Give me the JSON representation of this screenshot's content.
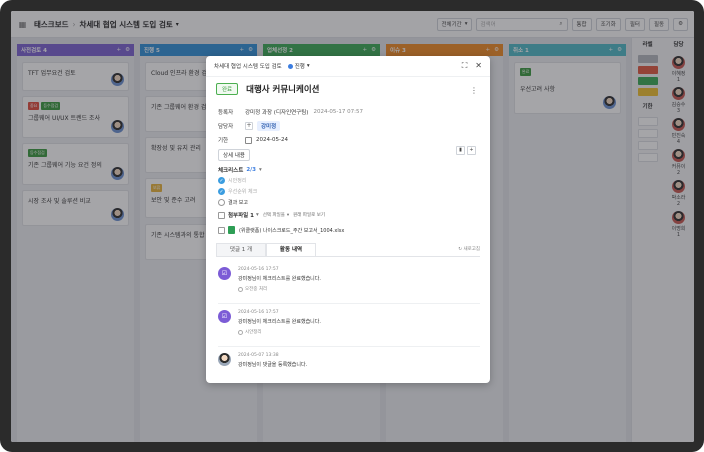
{
  "topbar": {
    "menu_icon": "grid-icon",
    "breadcrumb_root": "태스크보드",
    "breadcrumb_sep": "›",
    "breadcrumb_current": "차세대 협업 시스템 도입 검토",
    "period_select": "전체기간",
    "search_placeholder": "검색어",
    "buttons": [
      "통합",
      "조기화",
      "필터",
      "필동"
    ]
  },
  "columns": [
    {
      "title": "사전검토 4",
      "color": "#7b61d1",
      "cards": [
        {
          "text": "TFT 업무요건 검토",
          "tags": []
        },
        {
          "text": "그룹웨어 UI/UX 트렌드 조사",
          "tags": [
            {
              "label": "중요",
              "color": "#e04b3c"
            },
            {
              "label": "등수점검",
              "color": "#3a9a3e"
            }
          ]
        },
        {
          "text": "기존 그룹웨어 기능 요건 정의",
          "tags": [
            {
              "label": "등수점검",
              "color": "#3a9a3e"
            }
          ]
        },
        {
          "text": "시장 조사 및 솔루션 비교",
          "tags": []
        }
      ]
    },
    {
      "title": "진행 5",
      "color": "#2f8fd8",
      "cards": [
        {
          "text": "Cloud 인프라 환경 검토",
          "tags": []
        },
        {
          "text": "기존 그룹웨어 환경 검토",
          "tags": []
        },
        {
          "text": "확장성 및 유지 관리",
          "tags": []
        },
        {
          "text": "보안 및 준수 고려",
          "tags": [
            {
              "label": "보류",
              "color": "#e8b33a"
            }
          ]
        },
        {
          "text": "기존 시스템과의 통합",
          "tags": []
        }
      ]
    },
    {
      "title": "업체선정 2",
      "color": "#3aaa55",
      "cards": []
    },
    {
      "title": "이슈 3",
      "color": "#f08a24",
      "cards": []
    },
    {
      "title": "취소 1",
      "color": "#4fb8c6",
      "cards": [
        {
          "text": "우선고려 사항",
          "tags": [
            {
              "label": "완료",
              "color": "#3a9a3e"
            }
          ]
        }
      ]
    }
  ],
  "rightpanel": {
    "label_head": "라벨",
    "period_head": "기한",
    "assignee_head": "담당",
    "label_colors": [
      "#b3b7be",
      "#e0573e",
      "#3aaa55",
      "#f0c02e"
    ],
    "people": [
      {
        "name": "이혜정",
        "count": "1"
      },
      {
        "name": "김승수",
        "count": "3"
      },
      {
        "name": "민진숙",
        "count": "4"
      },
      {
        "name": "커뮤이",
        "count": "2"
      },
      {
        "name": "박소라",
        "count": "2"
      },
      {
        "name": "이명희",
        "count": "1"
      }
    ]
  },
  "modal": {
    "breadcrumb": "차세대 협업 시스템 도입 검토",
    "status": "진행",
    "status_caret": "▾",
    "expand_icon": "⛶",
    "close_icon": "✕",
    "badge": "완료",
    "title": "대행사 커뮤니케이션",
    "more": "⋮",
    "registrant_label": "등록자",
    "registrant": "강미정 과장 (디자인연구팀)",
    "registered_at": "2024-05-17 07:57",
    "assignee_label": "담당자",
    "assignee": "강미정",
    "due_label": "기한",
    "due": "2024-05-24",
    "detail_button": "상세 내용",
    "checklist_label": "체크리스트",
    "checklist_count": "2/3",
    "checklist_caret": "▾",
    "checklist": [
      {
        "text": "시안정리",
        "done": true
      },
      {
        "text": "우선순위 체크",
        "done": true
      },
      {
        "text": "결과 보고",
        "done": false
      }
    ],
    "attachment_label": "첨부파일 1",
    "attachment_caret": "▾",
    "attachment_select": "선택 파일을",
    "attachment_select_caret": "▾",
    "attachment_download": "원래 파일로 보기",
    "file_name": "(위클랫폼) 나이스크로드_주간 보고서_1004.xlsx",
    "tab_comments": "댓글 1 개",
    "tab_activity": "활동 내역",
    "refresh": "새로고침",
    "activities": [
      {
        "time": "2024-05-16 17:57",
        "message": "강미정님이 체크리스트를 완료했습니다.",
        "sub": "오전중 처리",
        "icon": "checklist-icon"
      },
      {
        "time": "2024-05-16 17:57",
        "message": "강미정님이 체크리스트를 완료했습니다.",
        "sub": "시안정리",
        "icon": "checklist-icon"
      },
      {
        "time": "2024-05-07 13:38",
        "message": "강미정님이 댓글을 등록했습니다.",
        "sub": "",
        "icon": "avatar"
      }
    ]
  }
}
